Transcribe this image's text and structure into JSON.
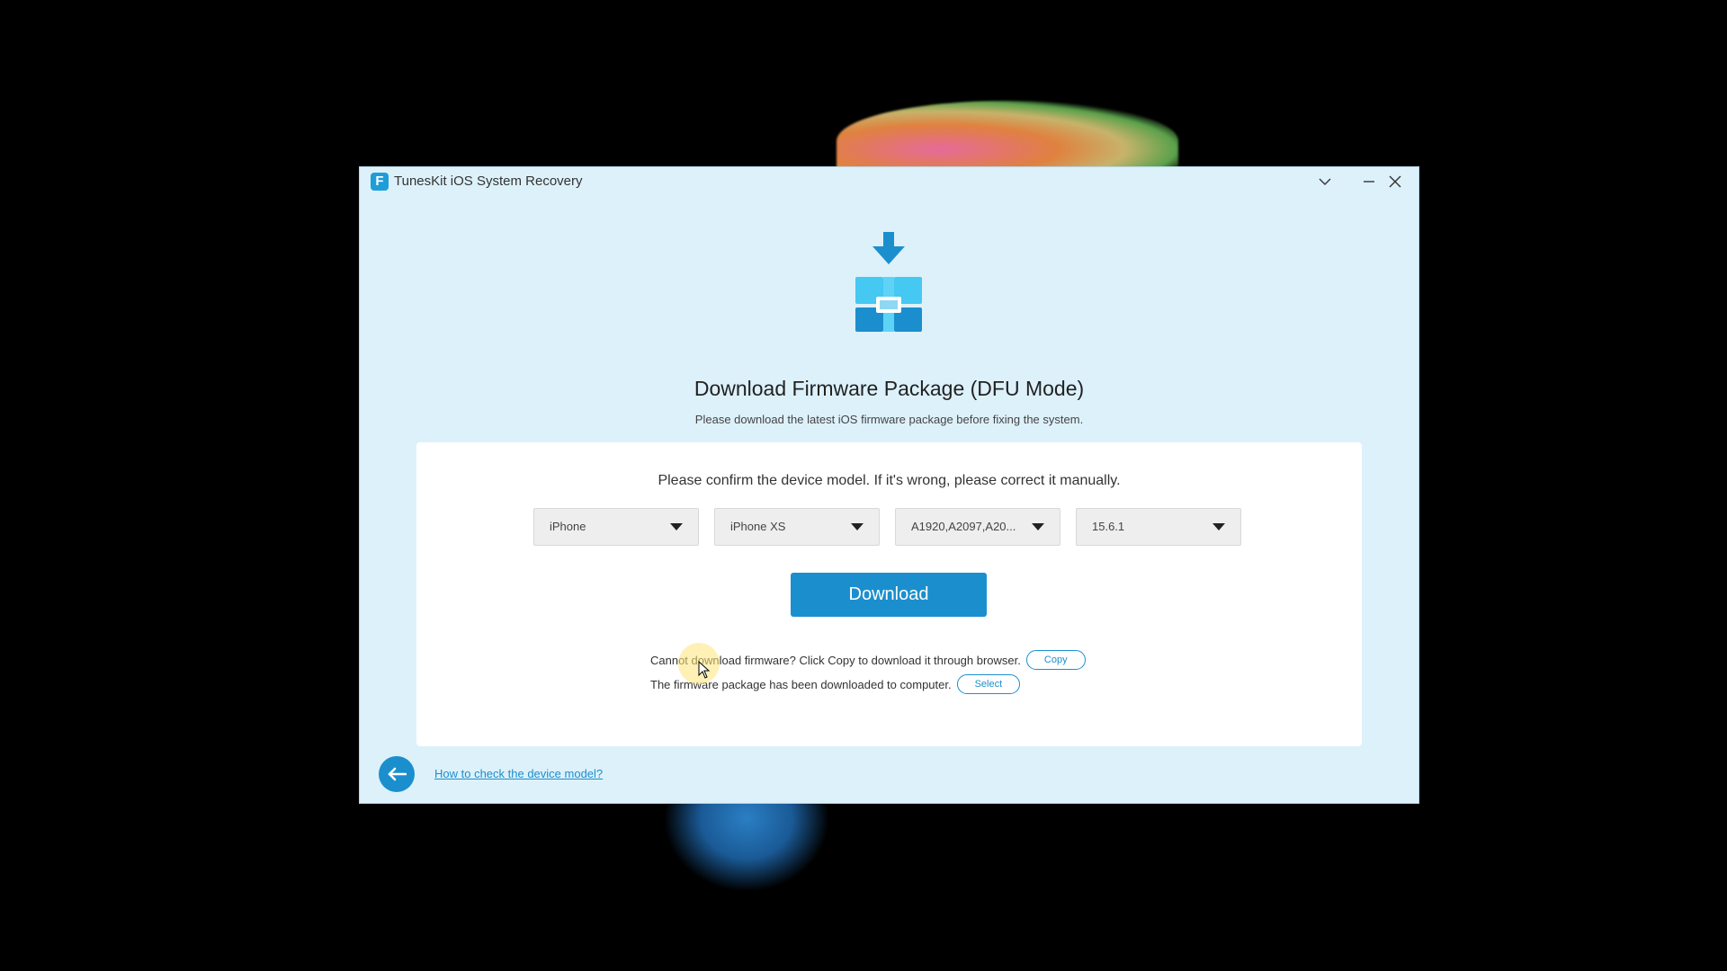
{
  "window": {
    "app_title": "TunesKit iOS System Recovery",
    "app_logo_glyph": "F",
    "controls": {
      "dropdown_icon": "chevron-down-icon",
      "minimize_icon": "minimize-icon",
      "close_icon": "close-icon"
    }
  },
  "main": {
    "icon": "firmware-package-download-icon",
    "title": "Download Firmware Package (DFU Mode)",
    "subtitle": "Please download the latest iOS firmware package before fixing the system.",
    "panel": {
      "confirm_text": "Please confirm the device model. If it's wrong, please correct it manually.",
      "selects": [
        {
          "value": "iPhone"
        },
        {
          "value": "iPhone XS"
        },
        {
          "value": "A1920,A2097,A20..."
        },
        {
          "value": "15.6.1"
        }
      ],
      "download_label": "Download",
      "copy_line": "Cannot download firmware? Click Copy to download it through browser.",
      "copy_label": "Copy",
      "select_line": "The firmware package has been downloaded to computer.",
      "select_label": "Select"
    }
  },
  "footer": {
    "back_icon": "arrow-left-icon",
    "help_link": "How to check the device model?"
  },
  "colors": {
    "accent": "#1b8fce",
    "window_bg": "#ddf1fb",
    "panel_bg": "#ffffff",
    "desktop_bg": "#000000"
  }
}
